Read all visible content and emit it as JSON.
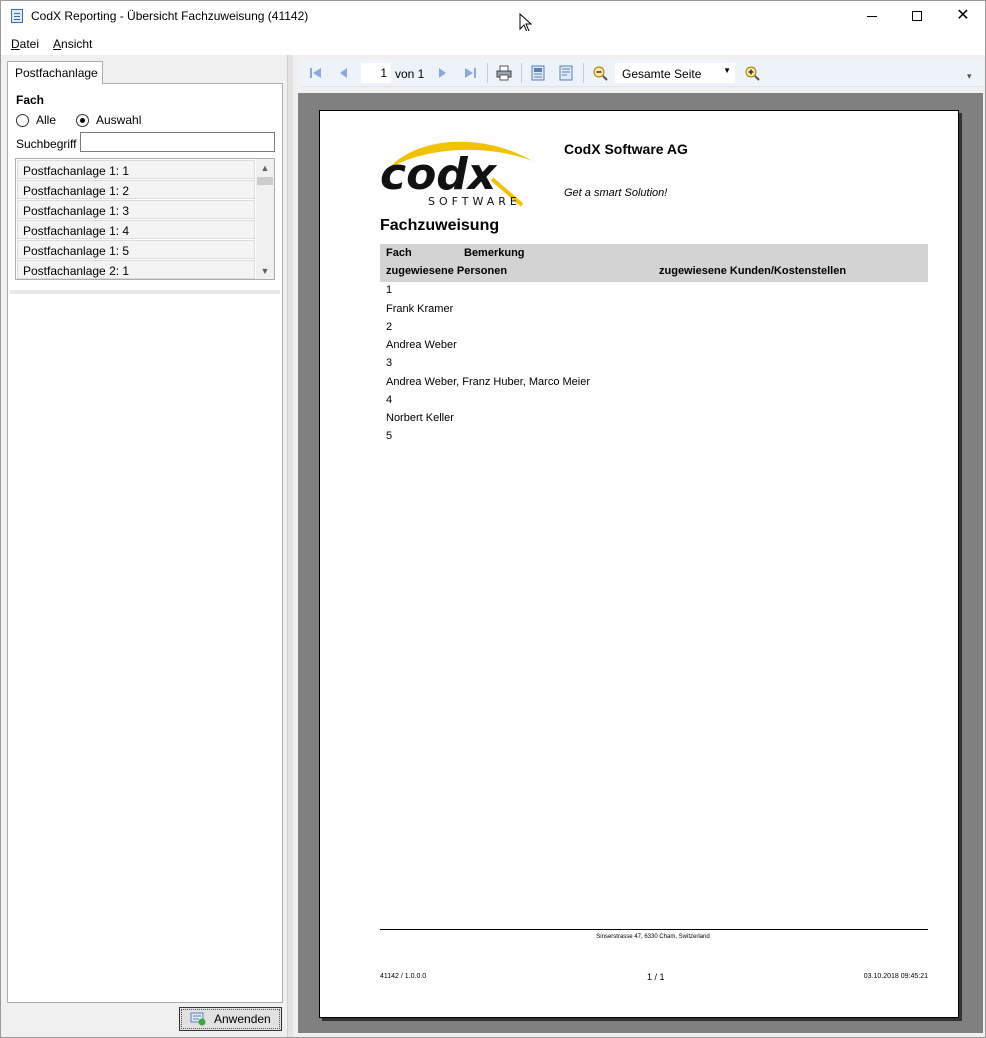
{
  "window": {
    "title": "CodX Reporting - Übersicht Fachzuweisung (41142)"
  },
  "menu": {
    "items": [
      {
        "label_underlined": "D",
        "label_rest": "atei"
      },
      {
        "label_underlined": "A",
        "label_rest": "nsicht"
      }
    ]
  },
  "left_panel": {
    "tab_label": "Postfachanlage",
    "section_label": "Fach",
    "radio_all": "Alle",
    "radio_selection": "Auswahl",
    "selected_radio": "Auswahl",
    "search_label": "Suchbegriff",
    "search_value": "",
    "list_items": [
      "Postfachanlage 1: 1",
      "Postfachanlage 1: 2",
      "Postfachanlage 1: 3",
      "Postfachanlage 1: 4",
      "Postfachanlage 1: 5",
      "Postfachanlage 2: 1"
    ],
    "apply_button": "Anwenden"
  },
  "toolbar": {
    "page_current": "1",
    "page_of": "von 1",
    "zoom": "Gesamte Seite"
  },
  "report": {
    "logo_text": "codx",
    "logo_sub": "SOFTWARE",
    "company": "CodX Software AG",
    "slogan": "Get a smart Solution!",
    "title": "Fachzuweisung",
    "col_fach": "Fach",
    "col_bemerkung": "Bemerkung",
    "col_personen": "zugewiesene Personen",
    "col_kunden": "zugewiesene Kunden/Kostenstellen",
    "rows": [
      "1",
      "Frank Kramer",
      "2",
      "Andrea Weber",
      "3",
      "Andrea Weber, Franz Huber, Marco Meier",
      "4",
      "Norbert Keller",
      "5"
    ],
    "footer_address": "Sinserstrasse 47, 6330 Cham, Switzerland",
    "footer_left": "41142 / 1.0.0.0",
    "footer_center": "1 / 1",
    "footer_right": "03.10.2018 09:45:21"
  },
  "colors": {
    "accent_yellow": "#f2c200",
    "toolbar_bg": "#eef3fa",
    "preview_bg": "#808080"
  }
}
